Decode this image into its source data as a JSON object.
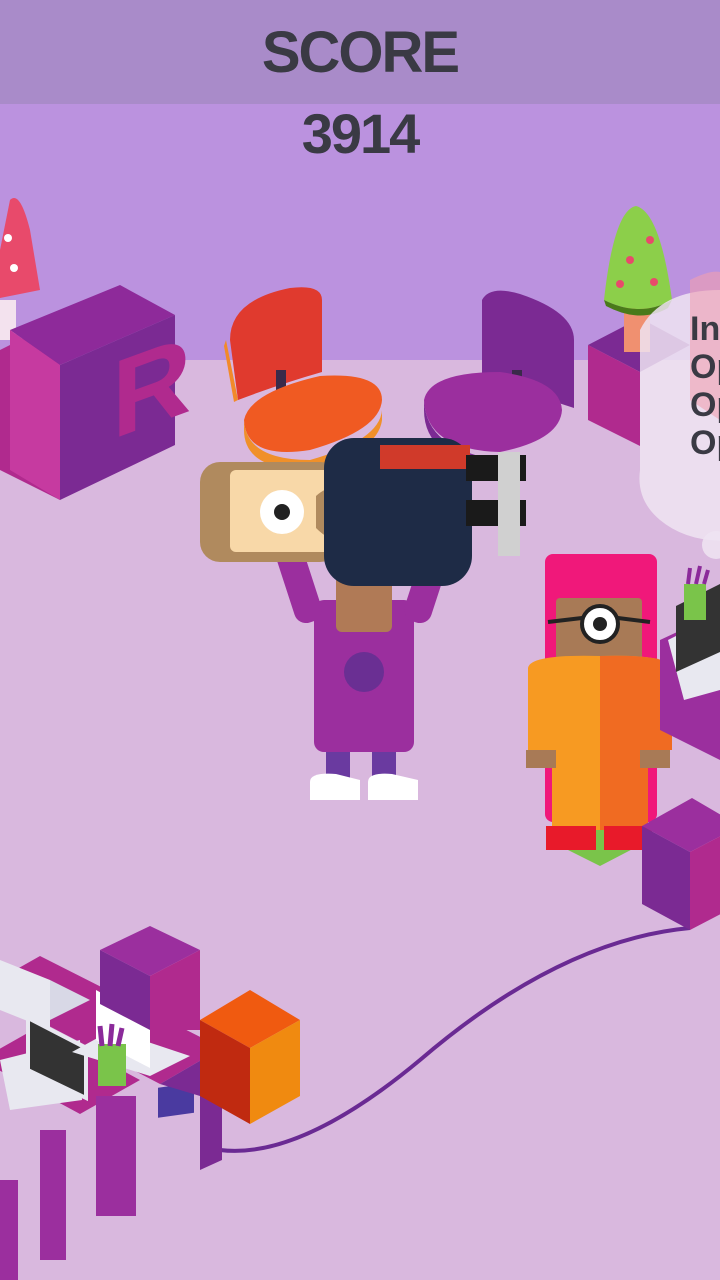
{
  "hud": {
    "score_label": "SCORE",
    "score_value": "3914"
  },
  "scene": {
    "sign_letter": "R",
    "speech_bubble_lines": [
      "In",
      "Op",
      "Op",
      "Op"
    ]
  },
  "colors": {
    "wall": "#bb92df",
    "floor": "#d9b8de",
    "hud_bar": "#a98bc9",
    "hud_text": "#3a3a44",
    "magenta": "#b02a8e",
    "purple": "#7b2a93",
    "orange": "#f07820"
  }
}
